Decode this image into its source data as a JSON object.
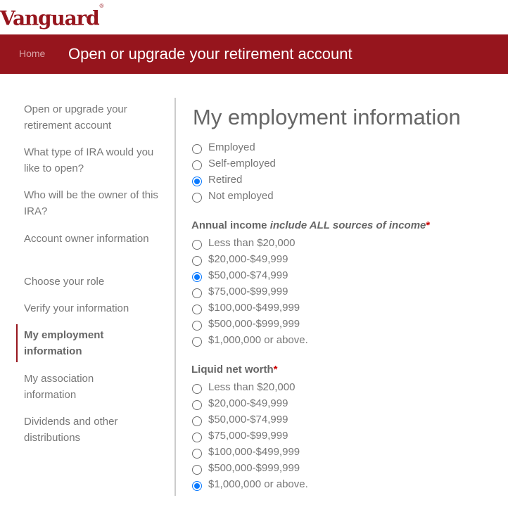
{
  "brand": {
    "logo_text": "Vanguard",
    "registered_mark": "®",
    "brand_color": "#96151d"
  },
  "banner": {
    "home_link": "Home",
    "title": "Open or upgrade your retirement account"
  },
  "sidebar": {
    "items": [
      {
        "label": "Open or upgrade your retirement account",
        "active": false
      },
      {
        "label": "What type of IRA would you like to open?",
        "active": false
      },
      {
        "label": "Who will be the owner of this IRA?",
        "active": false
      },
      {
        "label": "Account owner information",
        "active": false
      },
      {
        "label": "Choose your role",
        "active": false
      },
      {
        "label": "Verify your information",
        "active": false
      },
      {
        "label": "My employment information",
        "active": true
      },
      {
        "label": "My association information",
        "active": false
      },
      {
        "label": "Dividends and other distributions",
        "active": false
      }
    ]
  },
  "main": {
    "page_title": "My employment information",
    "employment_status": {
      "options": [
        "Employed",
        "Self-employed",
        "Retired",
        "Not employed"
      ],
      "selected": "Retired"
    },
    "annual_income": {
      "label": "Annual income",
      "label_hint": "include ALL sources of income",
      "required_mark": "*",
      "options": [
        "Less than $20,000",
        "$20,000-$49,999",
        "$50,000-$74,999",
        "$75,000-$99,999",
        "$100,000-$499,999",
        "$500,000-$999,999",
        "$1,000,000 or above."
      ],
      "selected": "$50,000-$74,999"
    },
    "liquid_net_worth": {
      "label": "Liquid net worth",
      "required_mark": "*",
      "options": [
        "Less than $20,000",
        "$20,000-$49,999",
        "$50,000-$74,999",
        "$75,000-$99,999",
        "$100,000-$499,999",
        "$500,000-$999,999",
        "$1,000,000 or above."
      ],
      "selected": "$1,000,000 or above."
    }
  },
  "colors": {
    "accent_radio": "#0a7aff",
    "required_star": "#cc0000",
    "text_gray": "#666666"
  }
}
